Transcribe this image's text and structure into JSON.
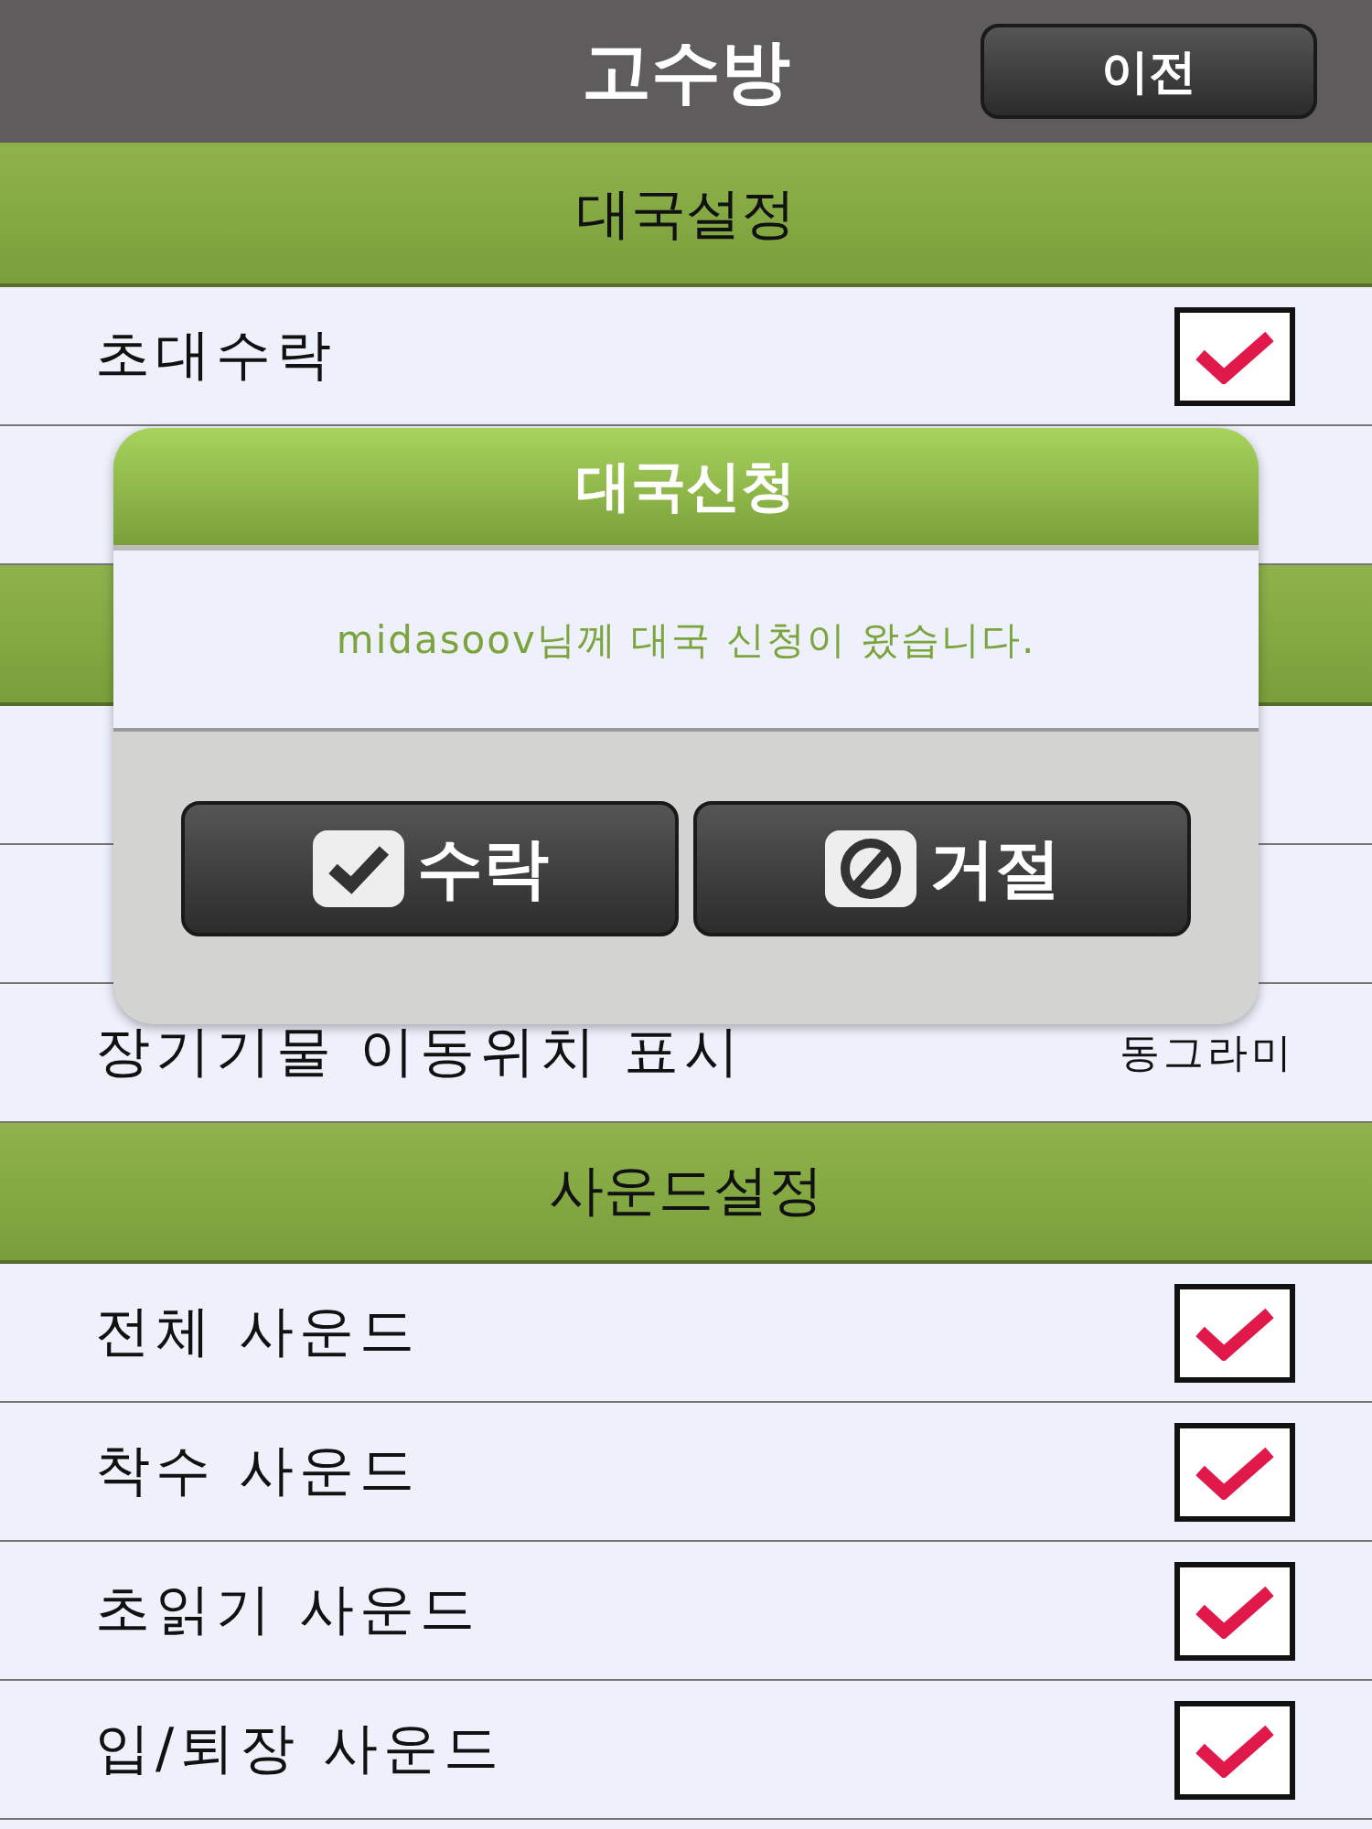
{
  "header": {
    "title": "고수방",
    "back_button": "이전"
  },
  "settings": [
    {
      "kind": "section",
      "label": "대국설정"
    },
    {
      "kind": "check",
      "label": "초대수락",
      "checked": true
    },
    {
      "kind": "covered"
    },
    {
      "kind": "covered_section"
    },
    {
      "kind": "covered"
    },
    {
      "kind": "covered"
    },
    {
      "kind": "option",
      "label": "장기기물 이동위치 표시",
      "value": "동그라미"
    },
    {
      "kind": "section",
      "label": "사운드설정"
    },
    {
      "kind": "check",
      "label": "전체 사운드",
      "checked": true
    },
    {
      "kind": "check",
      "label": "착수 사운드",
      "checked": true
    },
    {
      "kind": "check",
      "label": "초읽기 사운드",
      "checked": true
    },
    {
      "kind": "check",
      "label": "입/퇴장 사운드",
      "checked": true
    }
  ],
  "dialog": {
    "title": "대국신청",
    "message": "midasoov님께 대국 신청이 왔습니다.",
    "buttons": [
      {
        "kind": "accept",
        "label": "수락"
      },
      {
        "kind": "reject",
        "label": "거절"
      }
    ]
  }
}
